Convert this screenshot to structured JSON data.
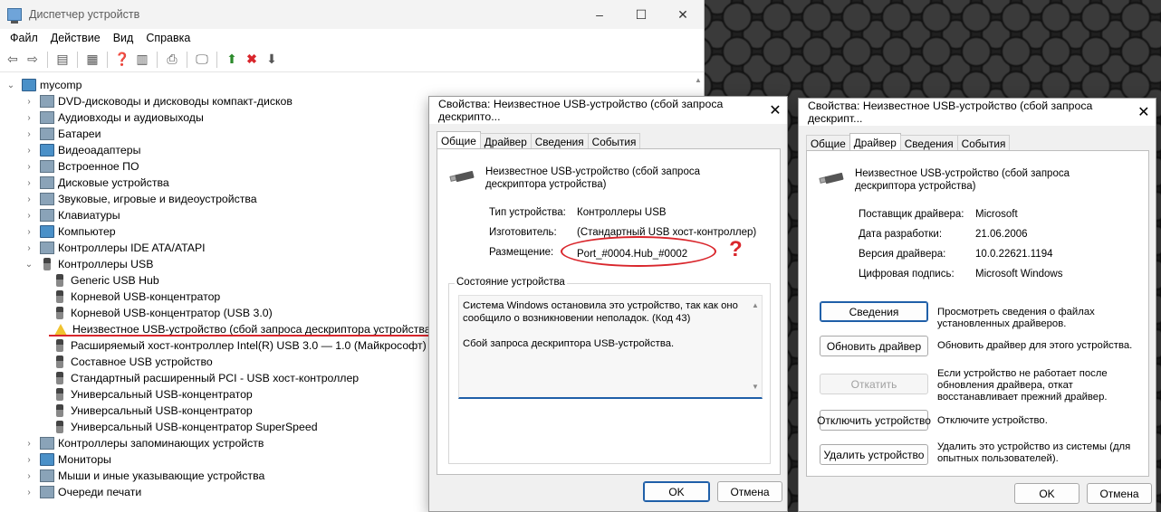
{
  "device_manager": {
    "title": "Диспетчер устройств",
    "window_buttons": [
      "–",
      "☐",
      "✕"
    ],
    "menu": [
      "Файл",
      "Действие",
      "Вид",
      "Справка"
    ],
    "tree": {
      "root": "mycomp",
      "categories_top": [
        "DVD-дисководы и дисководы компакт-дисков",
        "Аудиовходы и аудиовыходы",
        "Батареи",
        "Видеоадаптеры",
        "Встроенное ПО",
        "Дисковые устройства",
        "Звуковые, игровые и видеоустройства",
        "Клавиатуры",
        "Компьютер",
        "Контроллеры IDE ATA/ATAPI"
      ],
      "usb_category": "Контроллеры USB",
      "usb_devices": [
        "Generic USB Hub",
        "Корневой USB-концентратор",
        "Корневой USB-концентратор (USB 3.0)",
        "Неизвестное USB-устройство (сбой запроса дескриптора устройства)",
        "Расширяемый хост-контроллер Intel(R) USB 3.0 — 1.0 (Майкрософт)",
        "Составное USB устройство",
        "Стандартный расширенный PCI - USB хост-контроллер",
        "Универсальный USB-концентратор",
        "Универсальный USB-концентратор",
        "Универсальный USB-концентратор SuperSpeed"
      ],
      "categories_bottom": [
        "Контроллеры запоминающих устройств",
        "Мониторы",
        "Мыши и иные указывающие устройства",
        "Очереди печати"
      ]
    }
  },
  "dialog_general": {
    "title": "Свойства: Неизвестное USB-устройство (сбой запроса дескрипто...",
    "tabs": [
      "Общие",
      "Драйвер",
      "Сведения",
      "События"
    ],
    "device_name": "Неизвестное USB-устройство (сбой запроса дескриптора устройства)",
    "type_label": "Тип устройства:",
    "type_value": "Контроллеры USB",
    "mfr_label": "Изготовитель:",
    "mfr_value": "(Стандартный USB хост-контроллер)",
    "loc_label": "Размещение:",
    "loc_value": "Port_#0004.Hub_#0002",
    "status_group": "Состояние устройства",
    "status_line1": "Система Windows остановила это устройство, так как оно",
    "status_line2": "сообщило о возникновении неполадок. (Код 43)",
    "status_line3": "Сбой запроса дескриптора USB-устройства.",
    "ok": "OK",
    "cancel": "Отмена",
    "annotation_question": "?"
  },
  "dialog_driver": {
    "title": "Свойства: Неизвестное USB-устройство (сбой запроса дескрипт...",
    "tabs": [
      "Общие",
      "Драйвер",
      "Сведения",
      "События"
    ],
    "device_name": "Неизвестное USB-устройство (сбой запроса дескриптора устройства)",
    "provider_label": "Поставщик драйвера:",
    "provider_value": "Microsoft",
    "date_label": "Дата разработки:",
    "date_value": "21.06.2006",
    "version_label": "Версия драйвера:",
    "version_value": "10.0.22621.1194",
    "signer_label": "Цифровая подпись:",
    "signer_value": "Microsoft Windows",
    "actions": [
      {
        "label": "Сведения",
        "desc": "Просмотреть сведения о файлах установленных драйверов."
      },
      {
        "label": "Обновить драйвер",
        "desc": "Обновить драйвер для этого устройства."
      },
      {
        "label": "Откатить",
        "desc": "Если устройство не работает после обновления драйвера, откат восстанавливает прежний драйвер."
      },
      {
        "label": "Отключить устройство",
        "desc": "Отключите устройство."
      },
      {
        "label": "Удалить устройство",
        "desc": "Удалить это устройство из системы (для опытных пользователей)."
      }
    ],
    "ok": "OK",
    "cancel": "Отмена"
  },
  "colors": {
    "annotation_red": "#d9262c",
    "primary_button_border": "#1f5fa8"
  }
}
